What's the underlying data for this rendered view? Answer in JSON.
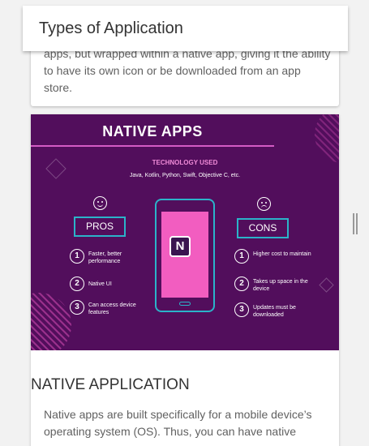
{
  "header": {
    "title": "Types of Application"
  },
  "previous_card": {
    "text": "apps, but wrapped within a native app, giving it the ability to have its own icon or be downloaded from an app store."
  },
  "infographic": {
    "title": "NATIVE APPS",
    "tech_heading": "TECHNOLOGY USED",
    "technologies": "Java, Kotlin, Python, Swift, Objective C, etc.",
    "app_icon_letter": "N",
    "pros": {
      "label": "PROS",
      "items": [
        {
          "num": "1",
          "text": "Faster, better performance"
        },
        {
          "num": "2",
          "text": "Native UI"
        },
        {
          "num": "3",
          "text": "Can access device features"
        }
      ]
    },
    "cons": {
      "label": "CONS",
      "items": [
        {
          "num": "1",
          "text": "Higher cost to maintain"
        },
        {
          "num": "2",
          "text": "Takes up space in the device"
        },
        {
          "num": "3",
          "text": "Updates must be downloaded"
        }
      ]
    }
  },
  "section": {
    "title": "NATIVE APPLICATION",
    "body": "Native apps are built specifically for a mobile device’s operating system (OS). Thus, you can have native"
  },
  "colors": {
    "infographic_bg": "#520e5c",
    "accent_cyan": "#2bb3c9",
    "accent_pink": "#f25dc0"
  }
}
